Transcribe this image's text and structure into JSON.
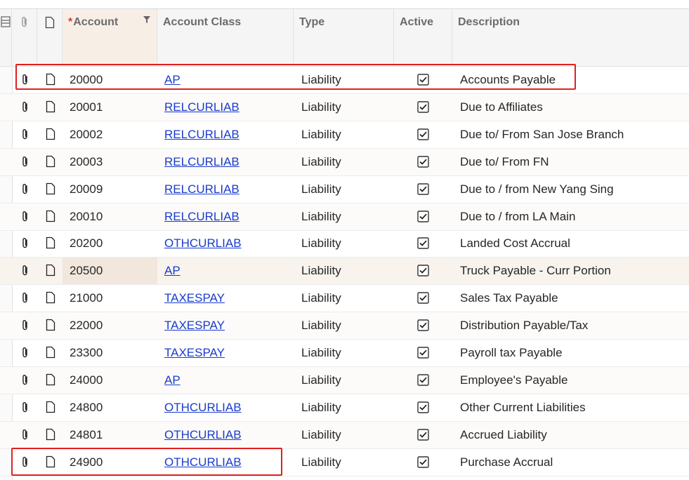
{
  "header": {
    "required_mark": "*",
    "account": "Account",
    "account_class": "Account Class",
    "type": "Type",
    "active": "Active",
    "description": "Description"
  },
  "header_icons": [
    "grid-settings-icon",
    "paperclip-icon",
    "document-icon",
    "filter-icon"
  ],
  "row_icons": [
    "paperclip-icon",
    "document-icon",
    "checkbox-checked-icon"
  ],
  "selected_row_index": 7,
  "highlight_color": "#e02020",
  "link_color": "#1a3bcc",
  "rows": [
    {
      "account": "20000",
      "account_class": "AP",
      "type": "Liability",
      "active": true,
      "description": "Accounts Payable"
    },
    {
      "account": "20001",
      "account_class": "RELCURLIAB",
      "type": "Liability",
      "active": true,
      "description": "Due to Affiliates"
    },
    {
      "account": "20002",
      "account_class": "RELCURLIAB",
      "type": "Liability",
      "active": true,
      "description": "Due to/ From San Jose Branch"
    },
    {
      "account": "20003",
      "account_class": "RELCURLIAB",
      "type": "Liability",
      "active": true,
      "description": "Due to/ From FN"
    },
    {
      "account": "20009",
      "account_class": "RELCURLIAB",
      "type": "Liability",
      "active": true,
      "description": "Due to / from New Yang Sing"
    },
    {
      "account": "20010",
      "account_class": "RELCURLIAB",
      "type": "Liability",
      "active": true,
      "description": "Due to / from LA Main"
    },
    {
      "account": "20200",
      "account_class": "OTHCURLIAB",
      "type": "Liability",
      "active": true,
      "description": "Landed Cost Accrual"
    },
    {
      "account": "20500",
      "account_class": "AP",
      "type": "Liability",
      "active": true,
      "description": "Truck Payable - Curr Portion"
    },
    {
      "account": "21000",
      "account_class": "TAXESPAY",
      "type": "Liability",
      "active": true,
      "description": "Sales Tax Payable"
    },
    {
      "account": "22000",
      "account_class": "TAXESPAY",
      "type": "Liability",
      "active": true,
      "description": "Distribution Payable/Tax"
    },
    {
      "account": "23300",
      "account_class": "TAXESPAY",
      "type": "Liability",
      "active": true,
      "description": "Payroll tax Payable"
    },
    {
      "account": "24000",
      "account_class": "AP",
      "type": "Liability",
      "active": true,
      "description": "Employee's Payable"
    },
    {
      "account": "24800",
      "account_class": "OTHCURLIAB",
      "type": "Liability",
      "active": true,
      "description": "Other Current Liabilities"
    },
    {
      "account": "24801",
      "account_class": "OTHCURLIAB",
      "type": "Liability",
      "active": true,
      "description": "Accrued Liability"
    },
    {
      "account": "24900",
      "account_class": "OTHCURLIAB",
      "type": "Liability",
      "active": true,
      "description": "Purchase Accrual"
    }
  ]
}
